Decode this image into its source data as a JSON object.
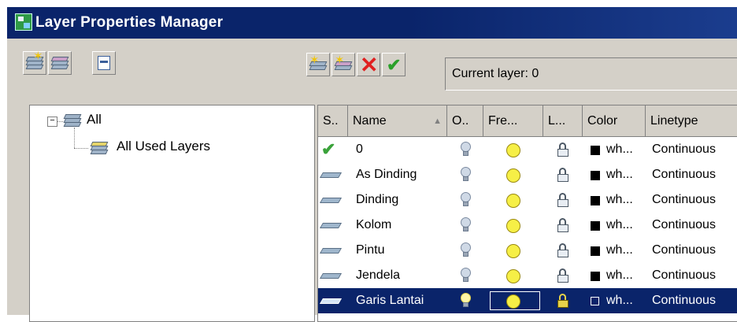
{
  "window": {
    "title": "Layer Properties Manager"
  },
  "toolbar": {
    "left_buttons": [
      "new-property-filter-icon",
      "new-group-filter-icon",
      "layer-states-manager-icon"
    ],
    "right_buttons": [
      "new-layer-icon",
      "new-layer-vp-frozen-icon",
      "delete-layer-icon",
      "set-current-icon"
    ],
    "current_layer_label": "Current layer: 0"
  },
  "tree": {
    "root_label": "All",
    "child_label": "All Used Layers",
    "expander": "−"
  },
  "grid": {
    "headers": [
      "S..",
      "Name",
      "O..",
      "Fre...",
      "L...",
      "Color",
      "Linetype"
    ],
    "sort_indicator": "▲",
    "rows": [
      {
        "status": "current",
        "name": "0",
        "color": "wh...",
        "linetype": "Continuous"
      },
      {
        "status": "layer",
        "name": "As Dinding",
        "color": "wh...",
        "linetype": "Continuous"
      },
      {
        "status": "layer",
        "name": "Dinding",
        "color": "wh...",
        "linetype": "Continuous"
      },
      {
        "status": "layer",
        "name": "Kolom",
        "color": "wh...",
        "linetype": "Continuous"
      },
      {
        "status": "layer",
        "name": "Pintu",
        "color": "wh...",
        "linetype": "Continuous"
      },
      {
        "status": "layer",
        "name": "Jendela",
        "color": "wh...",
        "linetype": "Continuous"
      },
      {
        "status": "layer",
        "name": "Garis Lantai",
        "color": "wh...",
        "linetype": "Continuous",
        "selected": true
      }
    ]
  },
  "colors": {
    "titlebar": "#0a246a",
    "selection": "#0a246a",
    "face": "#d4d0c8"
  }
}
